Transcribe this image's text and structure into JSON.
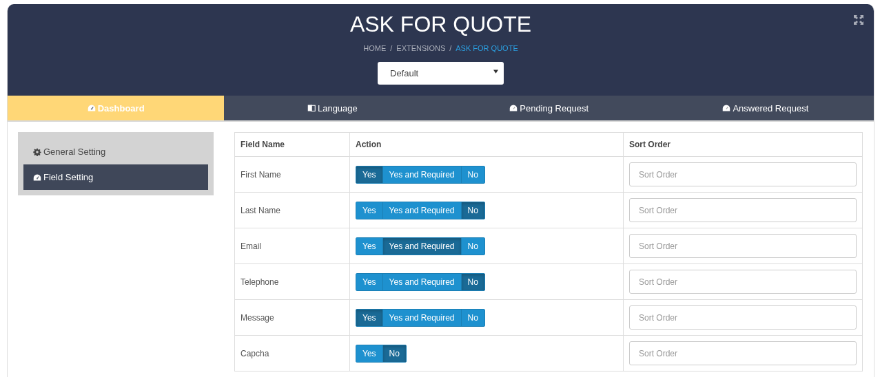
{
  "header": {
    "title": "ASK FOR QUOTE",
    "breadcrumb": [
      {
        "label": "HOME",
        "current": false
      },
      {
        "separator": "/",
        "label": "EXTENSIONS",
        "current": false
      },
      {
        "separator": "/",
        "label": "ASK FOR QUOTE",
        "current": true
      }
    ],
    "store_select": {
      "value": "Default"
    }
  },
  "tabs": [
    {
      "label": "Dashboard",
      "kind": "gauge",
      "selected": true
    },
    {
      "label": "Language",
      "kind": "language",
      "selected": false
    },
    {
      "label": "Pending Request",
      "kind": "gauge",
      "selected": false
    },
    {
      "label": "Answered Request",
      "kind": "gauge",
      "selected": false
    }
  ],
  "sidebar": {
    "items": [
      {
        "label": "General Setting",
        "kind": "gear",
        "selected": false
      },
      {
        "label": "Field Setting",
        "kind": "gauge",
        "selected": true
      }
    ]
  },
  "table": {
    "columns": [
      "Field Name",
      "Action",
      "Sort Order"
    ],
    "rows": [
      {
        "field": "First Name",
        "options": [
          {
            "label": "Yes",
            "selected": true
          },
          {
            "label": "Yes and Required",
            "selected": false
          },
          {
            "label": "No",
            "selected": false
          }
        ],
        "sort_placeholder": "Sort Order"
      },
      {
        "field": "Last Name",
        "options": [
          {
            "label": "Yes",
            "selected": false
          },
          {
            "label": "Yes and Required",
            "selected": false
          },
          {
            "label": "No",
            "selected": true
          }
        ],
        "sort_placeholder": "Sort Order"
      },
      {
        "field": "Email",
        "options": [
          {
            "label": "Yes",
            "selected": false
          },
          {
            "label": "Yes and Required",
            "selected": true
          },
          {
            "label": "No",
            "selected": false
          }
        ],
        "sort_placeholder": "Sort Order"
      },
      {
        "field": "Telephone",
        "options": [
          {
            "label": "Yes",
            "selected": false
          },
          {
            "label": "Yes and Required",
            "selected": false
          },
          {
            "label": "No",
            "selected": true
          }
        ],
        "sort_placeholder": "Sort Order"
      },
      {
        "field": "Message",
        "options": [
          {
            "label": "Yes",
            "selected": true
          },
          {
            "label": "Yes and Required",
            "selected": false
          },
          {
            "label": "No",
            "selected": false
          }
        ],
        "sort_placeholder": "Sort Order"
      },
      {
        "field": "Capcha",
        "options": [
          {
            "label": "Yes",
            "selected": false
          },
          {
            "label": "No",
            "selected": true
          }
        ],
        "sort_placeholder": "Sort Order"
      }
    ]
  }
}
